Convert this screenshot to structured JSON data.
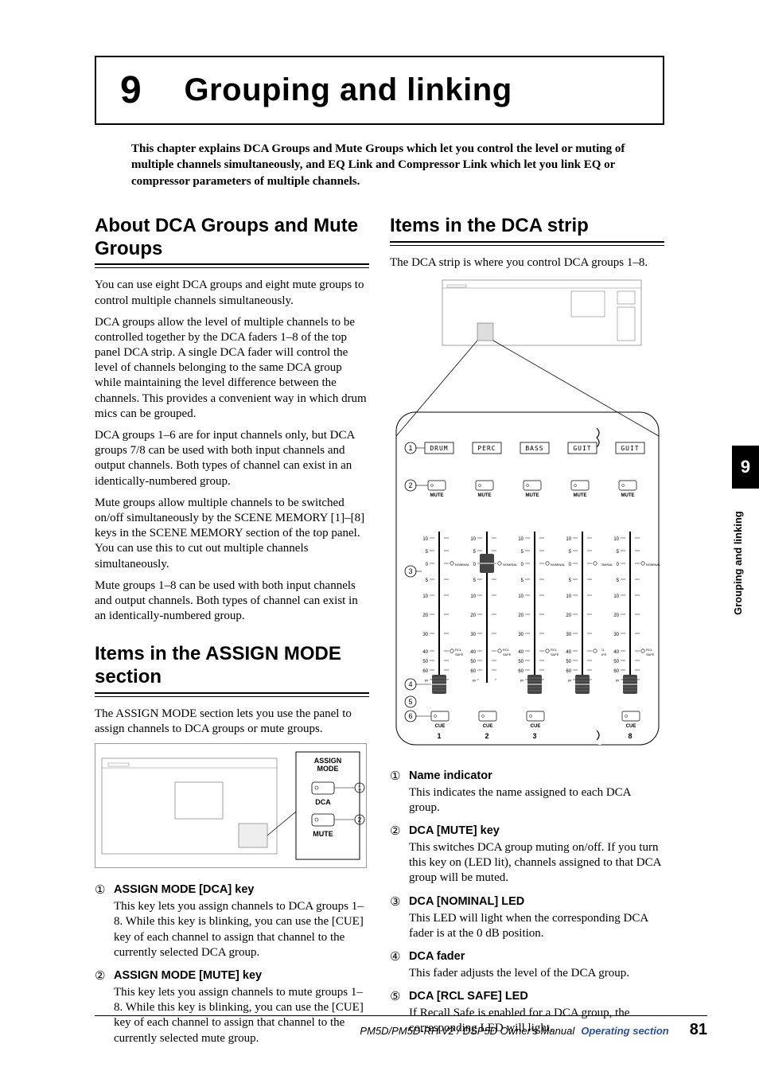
{
  "chapter": {
    "number": "9",
    "title": "Grouping and linking"
  },
  "intro": "This chapter explains DCA Groups and Mute Groups which let you control the level or muting of multiple channels simultaneously, and EQ Link and Compressor Link which let you link EQ or compressor parameters of multiple channels.",
  "sections": {
    "about": {
      "heading": "About DCA Groups and Mute Groups",
      "p1": "You can use eight DCA groups and eight mute groups to control multiple channels simultaneously.",
      "p2": "DCA groups allow the level of multiple channels to be controlled together by the DCA faders 1–8 of the top panel DCA strip. A single DCA fader will control the level of channels belonging to the same DCA group while maintaining the level difference between the channels. This provides a convenient way in which drum mics can be grouped.",
      "p3": "DCA groups 1–6 are for input channels only, but DCA groups 7/8 can be used with both input channels and output channels. Both types of channel can exist in an identically-numbered group.",
      "p4": "Mute groups allow multiple channels to be switched on/off simultaneously by the SCENE MEMORY [1]–[8] keys in the SCENE MEMORY section of the top panel. You can use this to cut out multiple channels simultaneously.",
      "p5": "Mute groups 1–8 can be used with both input channels and output channels. Both types of channel can exist in an identically-numbered group."
    },
    "assign": {
      "heading": "Items in the ASSIGN MODE section",
      "intro": "The ASSIGN MODE section lets you use the panel to assign channels to DCA groups or mute groups.",
      "panel_label": "ASSIGN MODE",
      "dca_label": "DCA",
      "mute_label": "MUTE",
      "items": [
        {
          "circ": "①",
          "label": "ASSIGN MODE [DCA] key",
          "text": "This key lets you assign channels to DCA groups 1–8. While this key is blinking, you can use the [CUE] key of each channel to assign that channel to the currently selected DCA group."
        },
        {
          "circ": "②",
          "label": "ASSIGN MODE [MUTE] key",
          "text": "This key lets you assign channels to mute groups 1–8. While this key is blinking, you can use the [CUE] key of each channel to assign that channel to the currently selected mute group."
        }
      ]
    },
    "dca": {
      "heading": "Items in the DCA strip",
      "intro": "The DCA strip is where you control DCA groups 1–8.",
      "names": [
        "DRUM",
        "PERC",
        "BASS",
        "GUIT",
        "GUIT"
      ],
      "mute_label": "MUTE",
      "cue_label": "CUE",
      "channel_numbers": [
        "1",
        "2",
        "3",
        "8"
      ],
      "fader_ticks": [
        "10",
        "5",
        "0",
        "5",
        "10",
        "20",
        "30",
        "40",
        "50",
        "60",
        "∞"
      ],
      "nominal_label": "NOMINAL",
      "rcl_safe_label": "RCL SAFE",
      "items": [
        {
          "circ": "①",
          "label": "Name indicator",
          "text": "This indicates the name assigned to each DCA group."
        },
        {
          "circ": "②",
          "label": "DCA [MUTE] key",
          "text": "This switches DCA group muting on/off. If you turn this key on (LED lit), channels assigned to that DCA group will be muted."
        },
        {
          "circ": "③",
          "label": "DCA [NOMINAL] LED",
          "text": "This LED will light when the corresponding DCA fader is at the 0 dB position."
        },
        {
          "circ": "④",
          "label": "DCA fader",
          "text": "This fader adjusts the level of the DCA group."
        },
        {
          "circ": "⑤",
          "label": "DCA [RCL SAFE] LED",
          "text": "If Recall Safe is enabled for a DCA group, the corresponding LED will light."
        }
      ]
    }
  },
  "side": {
    "number": "9",
    "label": "Grouping and linking"
  },
  "footer": {
    "manual": "PM5D/PM5D-RH V2 / DSP5D Owner's Manual",
    "section": "Operating section",
    "page": "81"
  }
}
